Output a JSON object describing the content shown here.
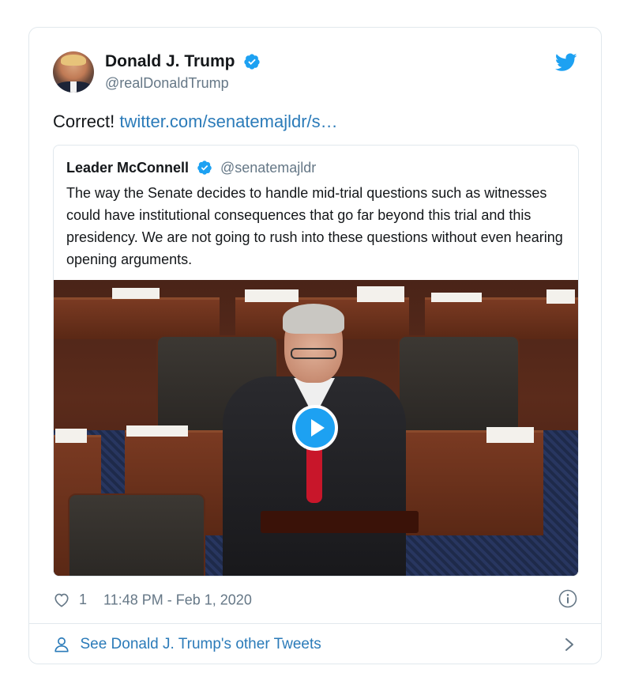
{
  "colors": {
    "accent": "#1da1f2",
    "link": "#2b7bb9",
    "secondary_text": "#657786",
    "border": "#e1e8ed"
  },
  "author": {
    "display_name": "Donald J. Trump",
    "handle": "@realDonaldTrump",
    "verified_icon": "verified-badge-icon"
  },
  "tweet": {
    "text": "Correct! ",
    "link_text": "twitter.com/senatemajldr/s…"
  },
  "quoted_tweet": {
    "display_name": "Leader McConnell",
    "handle": "@senatemajldr",
    "text": "The way the Senate decides to handle mid-trial questions such as witnesses could have institutional consequences that go far beyond this trial and this presidency. We are not going to rush into these questions without even hearing opening arguments.",
    "media": {
      "type": "video",
      "play_icon": "play-icon"
    }
  },
  "meta": {
    "like_icon": "heart-icon",
    "like_count": "1",
    "timestamp": "11:48 PM - Feb 1, 2020",
    "info_icon": "info-icon"
  },
  "footer": {
    "label": "See Donald J. Trump's other Tweets",
    "person_icon": "person-icon",
    "chevron_icon": "chevron-right-icon"
  },
  "brand_icon": "twitter-bird-icon"
}
